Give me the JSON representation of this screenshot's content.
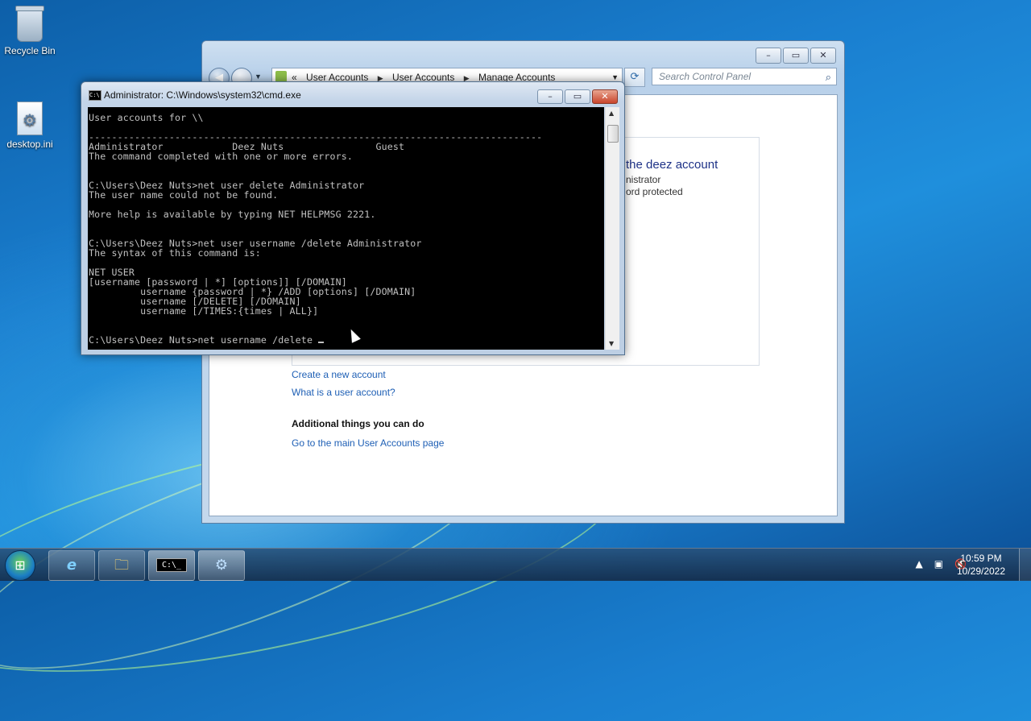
{
  "desktop": {
    "icons": [
      {
        "label": "Recycle Bin",
        "icon": "recycle-bin-icon"
      },
      {
        "label": "desktop.ini",
        "icon": "config-file-icon"
      }
    ]
  },
  "control_panel": {
    "breadcrumb": [
      "User Accounts",
      "User Accounts",
      "Manage Accounts"
    ],
    "breadcrumb_prefix": "«",
    "search_placeholder": "Search Control Panel",
    "account": {
      "name_fragment": "the deez account",
      "line1": "nistrator",
      "line2": "ord protected"
    },
    "links": {
      "create_account": "Create a new account",
      "what_is": "What is a user account?",
      "main_page": "Go to the main User Accounts page"
    },
    "additional_heading": "Additional things you can do"
  },
  "cmd": {
    "title": "Administrator: C:\\Windows\\system32\\cmd.exe",
    "lines": [
      "User accounts for \\\\",
      "",
      "-------------------------------------------------------------------------------",
      "Administrator            Deez Nuts                Guest",
      "The command completed with one or more errors.",
      "",
      "",
      "C:\\Users\\Deez Nuts>net user delete Administrator",
      "The user name could not be found.",
      "",
      "More help is available by typing NET HELPMSG 2221.",
      "",
      "",
      "C:\\Users\\Deez Nuts>net user username /delete Administrator",
      "The syntax of this command is:",
      "",
      "NET USER",
      "[username [password | *] [options]] [/DOMAIN]",
      "         username {password | *} /ADD [options] [/DOMAIN]",
      "         username [/DELETE] [/DOMAIN]",
      "         username [/TIMES:{times | ALL}]",
      "",
      ""
    ],
    "prompt_line": "C:\\Users\\Deez Nuts>net username /delete "
  },
  "taskbar": {
    "start_icon": "windows-start-icon",
    "programs": [
      {
        "name": "internet-explorer",
        "glyph": "e"
      },
      {
        "name": "file-explorer",
        "glyph": "🗀"
      },
      {
        "name": "command-prompt",
        "glyph": "C:\\_"
      },
      {
        "name": "control-panel",
        "glyph": "⚙"
      }
    ],
    "time": "10:59 PM",
    "date": "10/29/2022"
  }
}
